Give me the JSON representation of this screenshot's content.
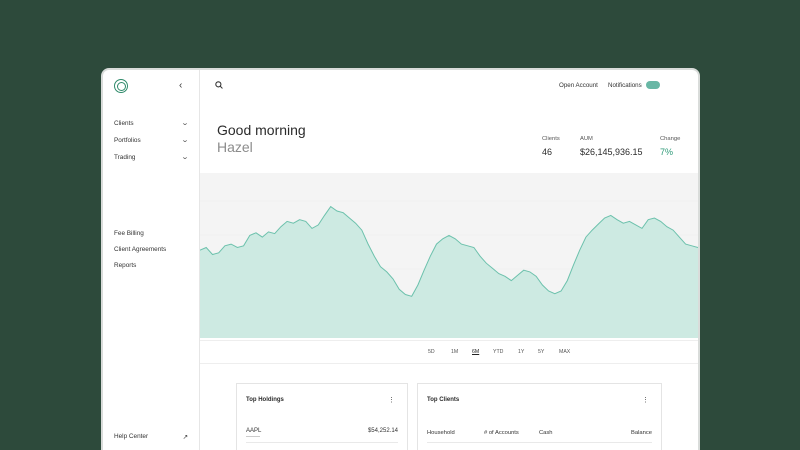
{
  "sidebar": {
    "collapse_glyph": "‹",
    "items": [
      {
        "label": "Clients",
        "chevron": "⌄"
      },
      {
        "label": "Portfolios",
        "chevron": "⌄"
      },
      {
        "label": "Trading",
        "chevron": "⌄"
      },
      {
        "label": "Fee Billing"
      },
      {
        "label": "Client Agreements"
      },
      {
        "label": "Reports"
      }
    ],
    "help": {
      "label": "Help Center",
      "glyph": "↗"
    }
  },
  "header": {
    "open_account": "Open Account",
    "notifications": "Notifications"
  },
  "greeting": {
    "line1": "Good morning",
    "line2": "Hazel"
  },
  "stats": [
    {
      "label": "Clients",
      "value": "46"
    },
    {
      "label": "AUM",
      "value": "$26,145,936.15"
    },
    {
      "label": "Change",
      "value": "7%"
    }
  ],
  "colors": {
    "accent": "#2f9a78",
    "fill": "#cdeae2",
    "line": "#6cc1ac",
    "chart_bg": "#f4f4f4"
  },
  "chart_data": {
    "type": "area",
    "series": [
      {
        "values": [
          0.55,
          0.58,
          0.5,
          0.52,
          0.6,
          0.62,
          0.58,
          0.6,
          0.72,
          0.75,
          0.7,
          0.76,
          0.74,
          0.82,
          0.88,
          0.86,
          0.9,
          0.88,
          0.8,
          0.84,
          0.95,
          1.05,
          1.0,
          0.98,
          0.92,
          0.86,
          0.78,
          0.62,
          0.48,
          0.36,
          0.3,
          0.22,
          0.1,
          0.04,
          0.02,
          0.15,
          0.32,
          0.48,
          0.62,
          0.68,
          0.72,
          0.68,
          0.62,
          0.6,
          0.58,
          0.48,
          0.4,
          0.34,
          0.28,
          0.25,
          0.2,
          0.26,
          0.32,
          0.3,
          0.25,
          0.15,
          0.08,
          0.05,
          0.08,
          0.2,
          0.38,
          0.55,
          0.7,
          0.78,
          0.85,
          0.92,
          0.95,
          0.9,
          0.86,
          0.88,
          0.84,
          0.8,
          0.9,
          0.92,
          0.88,
          0.82,
          0.78,
          0.7,
          0.62,
          0.6,
          0.58
        ]
      }
    ],
    "ranges": [
      "5D",
      "1M",
      "6M",
      "YTD",
      "1Y",
      "5Y",
      "MAX"
    ],
    "selected_range": "6M"
  },
  "top_holdings": {
    "title": "Top Holdings",
    "menu": "⋮",
    "rows": [
      {
        "symbol": "AAPL",
        "value": "$54,252.14"
      }
    ]
  },
  "top_clients": {
    "title": "Top Clients",
    "menu": "⋮",
    "columns": [
      "Household",
      "# of Accounts",
      "Cash",
      "Balance"
    ]
  }
}
